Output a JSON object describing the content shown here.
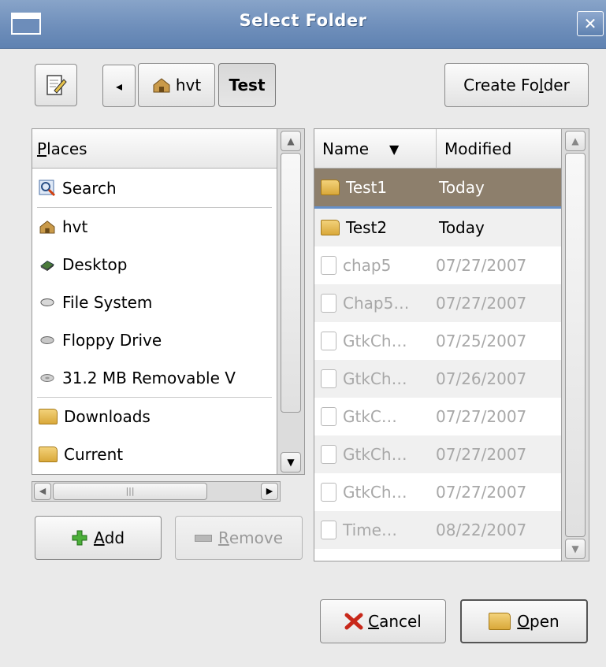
{
  "window": {
    "title": "Select Folder",
    "close_glyph": "✕"
  },
  "toolbar": {
    "edit_icon": "edit-path-icon",
    "back_glyph": "◂",
    "path": [
      {
        "label": "hvt"
      },
      {
        "label": "Test"
      }
    ],
    "create_folder_pre": "Create Fo",
    "create_folder_key": "l",
    "create_folder_post": "der"
  },
  "places": {
    "header_key": "P",
    "header_rest": "laces",
    "items": [
      {
        "label": "Search",
        "icon": "search-icon"
      },
      {
        "label": "hvt",
        "icon": "home-icon"
      },
      {
        "label": "Desktop",
        "icon": "desktop-icon"
      },
      {
        "label": "File System",
        "icon": "drive-icon"
      },
      {
        "label": "Floppy Drive",
        "icon": "floppy-icon"
      },
      {
        "label": "31.2 MB Removable V",
        "icon": "removable-drive-icon"
      },
      {
        "label": "Downloads",
        "icon": "folder-icon"
      },
      {
        "label": "Current",
        "icon": "folder-icon"
      }
    ],
    "add_key": "A",
    "add_rest": "dd",
    "remove_key": "R",
    "remove_rest": "emove"
  },
  "files": {
    "col_name": "Name",
    "col_modified": "Modified",
    "sort_glyph": "▼",
    "rows": [
      {
        "name": "Test1",
        "modified": "Today",
        "type": "folder"
      },
      {
        "name": "Test2",
        "modified": "Today",
        "type": "folder"
      },
      {
        "name": "chap5",
        "modified": "07/27/2007",
        "type": "file"
      },
      {
        "name": "Chap5…",
        "modified": "07/27/2007",
        "type": "file"
      },
      {
        "name": "GtkCh…",
        "modified": "07/25/2007",
        "type": "file"
      },
      {
        "name": "GtkCh…",
        "modified": "07/26/2007",
        "type": "file"
      },
      {
        "name": "GtkC…",
        "modified": "07/27/2007",
        "type": "file"
      },
      {
        "name": "GtkCh…",
        "modified": "07/27/2007",
        "type": "file"
      },
      {
        "name": "GtkCh…",
        "modified": "07/27/2007",
        "type": "file"
      },
      {
        "name": "Time…",
        "modified": "08/22/2007",
        "type": "file"
      }
    ]
  },
  "actions": {
    "cancel_key": "C",
    "cancel_rest": "ancel",
    "open_key": "O",
    "open_rest": "pen"
  },
  "colors": {
    "selection": "#8d7f6c",
    "titlebar": "#7393bf",
    "dimmed_text": "#a8a8a8"
  }
}
